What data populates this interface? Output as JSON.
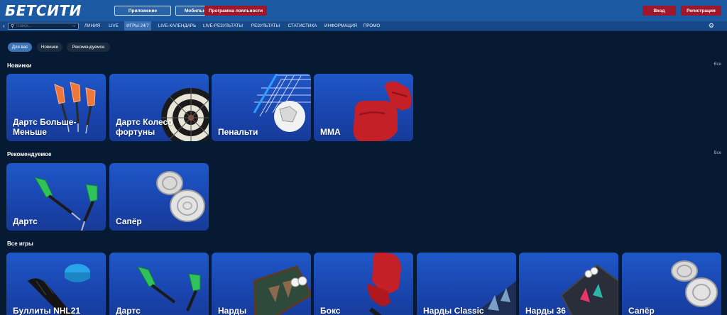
{
  "header": {
    "logo": "БЕТСИТИ",
    "btn_app": "Приложение",
    "btn_mobile": "Мобильный сайт",
    "btn_loyalty": "Программа лояльности",
    "btn_login": "Вход",
    "btn_register": "Регистрация"
  },
  "nav": {
    "search_placeholder": "Поиск...",
    "items": [
      "ЛИНИЯ",
      "LIVE",
      "ИГРЫ 24/7",
      "LIVE-КАЛЕНДАРЬ",
      "LIVE-РЕЗУЛЬТАТЫ",
      "РЕЗУЛЬТАТЫ",
      "СТАТИСТИКА",
      "ИНФОРМАЦИЯ",
      "ПРОМО"
    ],
    "active": "ИГРЫ 24/7"
  },
  "chips": [
    "Для вас",
    "Новинки",
    "Рекомендуемое"
  ],
  "sections": {
    "new": {
      "title": "Новинки",
      "all": "Все",
      "games": [
        "Дартс Больше-Меньше",
        "Дартс Колесо фортуны",
        "Пенальти",
        "MMA"
      ]
    },
    "rec": {
      "title": "Рекомендуемое",
      "all": "Все",
      "games": [
        "Дартс",
        "Сапёр"
      ]
    },
    "allgames": {
      "title": "Все игры",
      "games": [
        "Буллиты NHL21",
        "Дартс",
        "Нарды",
        "Бокс",
        "Нарды Classic",
        "Нарды 36",
        "Сапёр"
      ]
    }
  },
  "colors": {
    "header": "#1c5aa3",
    "nav": "#174888",
    "background": "#061a33",
    "accent_red": "#a0172b",
    "card_blue": "#1f57c8"
  }
}
